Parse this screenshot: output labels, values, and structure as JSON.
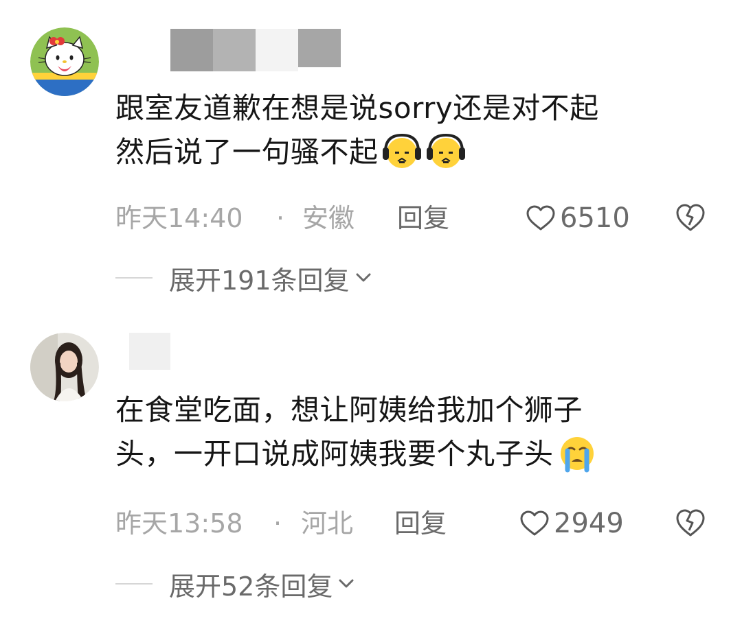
{
  "comments": [
    {
      "text_lines": [
        "跟室友道歉在想是说sorry还是对不起",
        "然后说了一句骚不起"
      ],
      "emojis": [
        "headphone-sweat-emoji",
        "headphone-sweat-emoji"
      ],
      "time": "昨天14:40",
      "separator": "·",
      "location": "安徽",
      "reply_label": "回复",
      "like_count": "6510",
      "expand_label": "展开191条回复"
    },
    {
      "text_lines": [
        "在食堂吃面，想让阿姨给我加个狮子",
        "头，一开口说成阿姨我要个丸子头"
      ],
      "emojis": [
        "crying-emoji"
      ],
      "time": "昨天13:58",
      "separator": "·",
      "location": "河北",
      "reply_label": "回复",
      "like_count": "2949",
      "expand_label": "展开52条回复"
    }
  ],
  "colors": {
    "text": "#161616",
    "meta": "#a6a6a6",
    "action": "#6a6a6a",
    "icon": "#555555",
    "emoji_yellow": "#ffd23a"
  },
  "icons": {
    "like": "heart-outline-icon",
    "dislike": "broken-heart-icon",
    "expand": "chevron-down-icon"
  }
}
